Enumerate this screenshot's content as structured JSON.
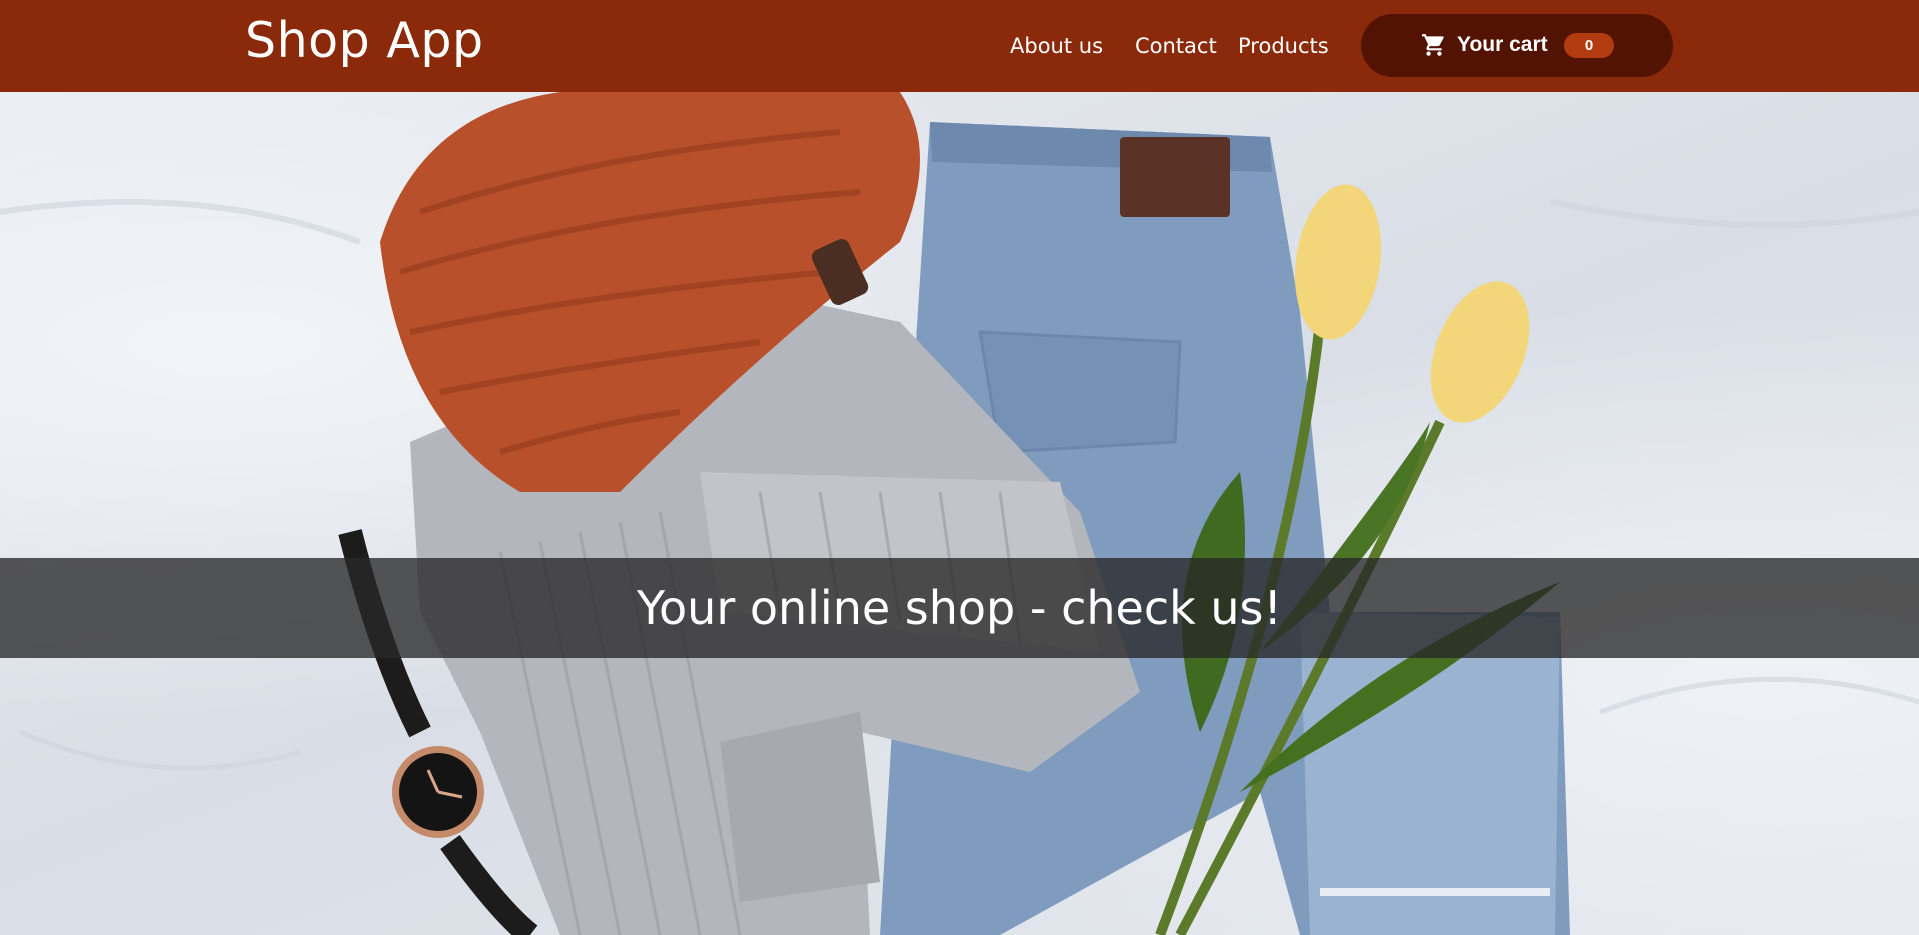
{
  "header": {
    "logo": "Shop App",
    "nav": {
      "about": "About us",
      "contact": "Contact",
      "products": "Products"
    },
    "cart": {
      "icon": "cart-icon",
      "label": "Your cart",
      "count": "0"
    }
  },
  "hero": {
    "tagline": "Your online shop - check us!"
  },
  "colors": {
    "header_bg": "#8a2a0a",
    "cart_button_bg": "#521303",
    "cart_badge_bg": "#b23c10"
  }
}
